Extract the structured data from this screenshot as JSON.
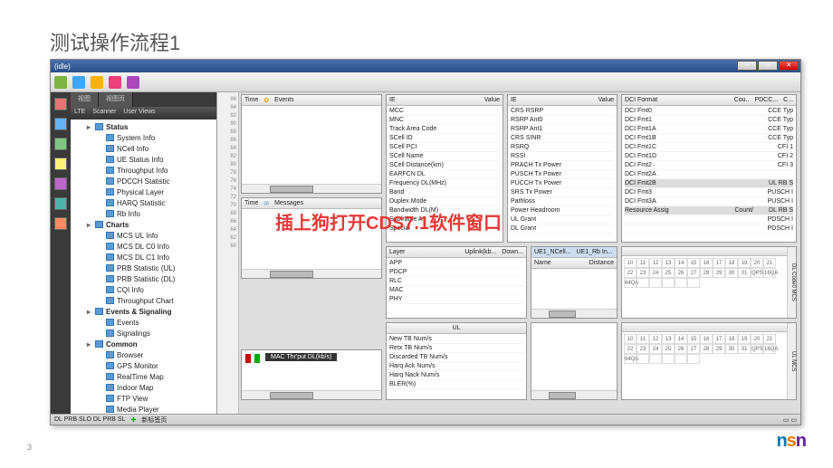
{
  "slide": {
    "title": "测试操作流程1",
    "page": "3"
  },
  "annotation": "插上狗打开CDS7.1软件窗口",
  "window": {
    "title": "(idle)"
  },
  "tree_tabs": {
    "a": "视图",
    "b": "视图页"
  },
  "tree_sub": {
    "a": "LTE",
    "b": "Scanner",
    "c": "User Views"
  },
  "tree": [
    {
      "lvl": 1,
      "cat": true,
      "tog": "▸",
      "label": "Status"
    },
    {
      "lvl": 2,
      "label": "System Info"
    },
    {
      "lvl": 2,
      "label": "NCell Info"
    },
    {
      "lvl": 2,
      "label": "UE Status Info"
    },
    {
      "lvl": 2,
      "label": "Throughput Info"
    },
    {
      "lvl": 2,
      "label": "PDCCH Statistic"
    },
    {
      "lvl": 2,
      "label": "Physical Layer"
    },
    {
      "lvl": 2,
      "label": "HARQ Statistic"
    },
    {
      "lvl": 2,
      "label": "Rb Info"
    },
    {
      "lvl": 1,
      "cat": true,
      "tog": "▸",
      "label": "Charts"
    },
    {
      "lvl": 2,
      "label": "MCS UL Info"
    },
    {
      "lvl": 2,
      "label": "MCS DL C0 Info"
    },
    {
      "lvl": 2,
      "label": "MCS DL C1 Info"
    },
    {
      "lvl": 2,
      "label": "PRB Statistic (UL)"
    },
    {
      "lvl": 2,
      "label": "PRB Statistic (DL)"
    },
    {
      "lvl": 2,
      "label": "CQI Info"
    },
    {
      "lvl": 2,
      "label": "Throughput Chart"
    },
    {
      "lvl": 1,
      "cat": true,
      "tog": "▸",
      "label": "Events & Signaling"
    },
    {
      "lvl": 2,
      "label": "Events"
    },
    {
      "lvl": 2,
      "label": "Signalings"
    },
    {
      "lvl": 1,
      "cat": true,
      "tog": "▸",
      "label": "Common"
    },
    {
      "lvl": 2,
      "label": "Browser"
    },
    {
      "lvl": 2,
      "label": "GPS Monitor"
    },
    {
      "lvl": 2,
      "label": "RealTime Map"
    },
    {
      "lvl": 2,
      "label": "Indoor Map"
    },
    {
      "lvl": 2,
      "label": "FTP View"
    },
    {
      "lvl": 2,
      "label": "Media Player"
    }
  ],
  "gutter": [
    "96",
    "94",
    "92",
    "90",
    "88",
    "86",
    "84",
    "82",
    "80",
    "78",
    "76",
    "74",
    "72",
    "70",
    "68",
    "66",
    "64",
    "62",
    "60"
  ],
  "events_panel": {
    "time": "Time",
    "events": "Events"
  },
  "msg_panel": {
    "time": "Time",
    "msg": "Messages"
  },
  "ie1": {
    "hIE": "IE",
    "hVal": "Value",
    "rows": [
      "MCC",
      "MNC",
      "Track Area Code",
      "SCell ID",
      "SCell PCI",
      "SCell Name",
      "SCell Distance(km)",
      "EARFCN DL",
      "Frequency DL(MHz)",
      "Band",
      "Duplex Mode",
      "Bandwidth DL(M)",
      "Subframe A",
      "Special"
    ]
  },
  "ie2": {
    "hIE": "IE",
    "hVal": "Value",
    "rows": [
      "CRS RSRP",
      "RSRP Ant0",
      "RSRP Ant1",
      "CRS SINR",
      "RSRQ",
      "RSSI",
      "PRACH Tx Power",
      "PUSCH Tx Power",
      "PUCCH Tx Power",
      "SRS Tx Power",
      "Pathloss",
      "Power Headroom",
      "UL Grant",
      "DL Grant"
    ]
  },
  "dci": {
    "hFmt": "DCI Format",
    "hCou": "Cou..",
    "hPdc": "PDCC...",
    "hC": "C...",
    "rows": [
      {
        "a": "DCI Fmt0",
        "c": "CCE Typ"
      },
      {
        "a": "DCI Fmt1",
        "c": "CCE Typ"
      },
      {
        "a": "DCI Fmt1A",
        "c": "CCE Typ"
      },
      {
        "a": "DCI Fmt1B",
        "c": "CCE Typ"
      },
      {
        "a": "DCI Fmt1C",
        "c": "CFI 1"
      },
      {
        "a": "DCI Fmt1D",
        "c": "CFI 2"
      },
      {
        "a": "DCI Fmt2",
        "c": "CFI 3"
      },
      {
        "a": "DCI Fmt2A",
        "c": ""
      },
      {
        "a": "DCI Fmt2B",
        "c": "UL RB S",
        "hl": true
      },
      {
        "a": "DCI Fmt3",
        "c": "PUSCH I"
      },
      {
        "a": "DCI Fmt3A",
        "c": "PUSCH I"
      },
      {
        "a": "Resource Assig",
        "b": "Count/",
        "c": "DL RB S",
        "hl": true
      },
      {
        "a": "",
        "c": "PDSCH I"
      },
      {
        "a": "",
        "c": "PDSCH I"
      }
    ]
  },
  "layer": {
    "hLayer": "Layer",
    "hUp": "Uplink(kb...",
    "hDown": "Down...",
    "rows": [
      "APP",
      "PDCP",
      "RLC",
      "MAC",
      "PHY"
    ]
  },
  "ncell": {
    "tab1": "UE1_NCell...",
    "tab2": "UE1_Rb In...",
    "hName": "Name",
    "hDist": "Distance"
  },
  "ul_panel": {
    "title": "UL",
    "rows": [
      "New TB Num/s",
      "Retx TB Num/s",
      "Discarded TB Num/s",
      "Harq Ack Num/s",
      "Harq Nack Num/s",
      "BLER(%)"
    ]
  },
  "mcs_grid": {
    "side1": "DL Code0 MCS",
    "side2": "UL MCS",
    "row1": [
      "10",
      "11",
      "12",
      "13",
      "14",
      "15",
      "16",
      "17",
      "18",
      "19"
    ],
    "row2": [
      "20",
      "21",
      "22",
      "23",
      "24",
      "25",
      "26",
      "27",
      "28",
      "29"
    ],
    "row3": [
      "30",
      "31",
      "QPS",
      "16QA",
      "64QA",
      "",
      "",
      "",
      "",
      ""
    ]
  },
  "mac": "MAC Thr'put DL(kb/s)",
  "bottom_tabs": "DL PRB  SLO  DL PRB  SL",
  "newtab": "新标签页"
}
